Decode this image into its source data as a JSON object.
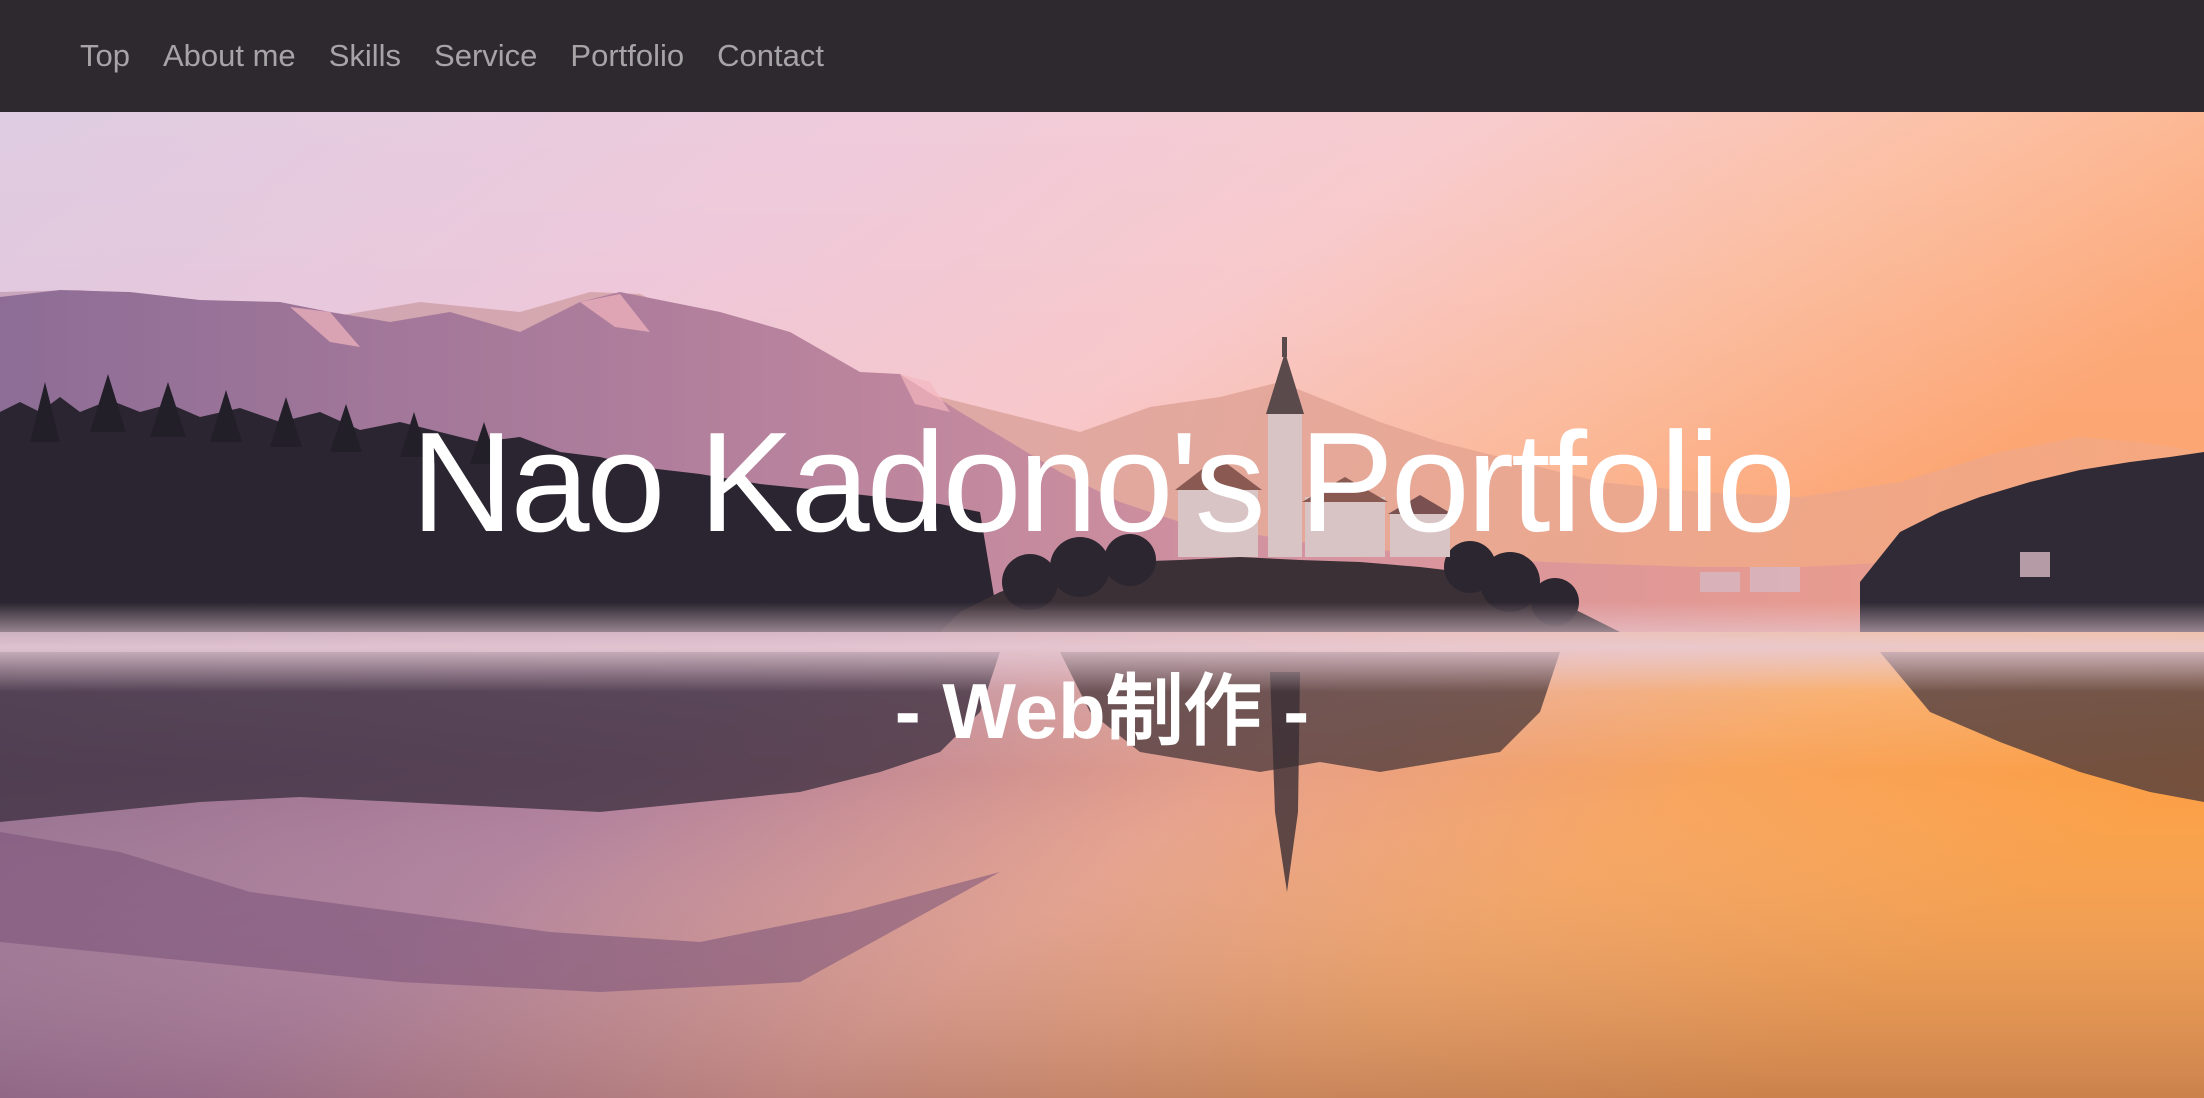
{
  "nav": {
    "items": [
      {
        "label": "Top"
      },
      {
        "label": "About me"
      },
      {
        "label": "Skills"
      },
      {
        "label": "Service"
      },
      {
        "label": "Portfolio"
      },
      {
        "label": "Contact"
      }
    ]
  },
  "hero": {
    "title": "Nao Kadono's Portfolio",
    "subtitle": "- Web制作 -"
  },
  "colors": {
    "navbar_bg": "#2d292e",
    "nav_text": "#a7a4a8",
    "hero_text": "#ffffff"
  }
}
